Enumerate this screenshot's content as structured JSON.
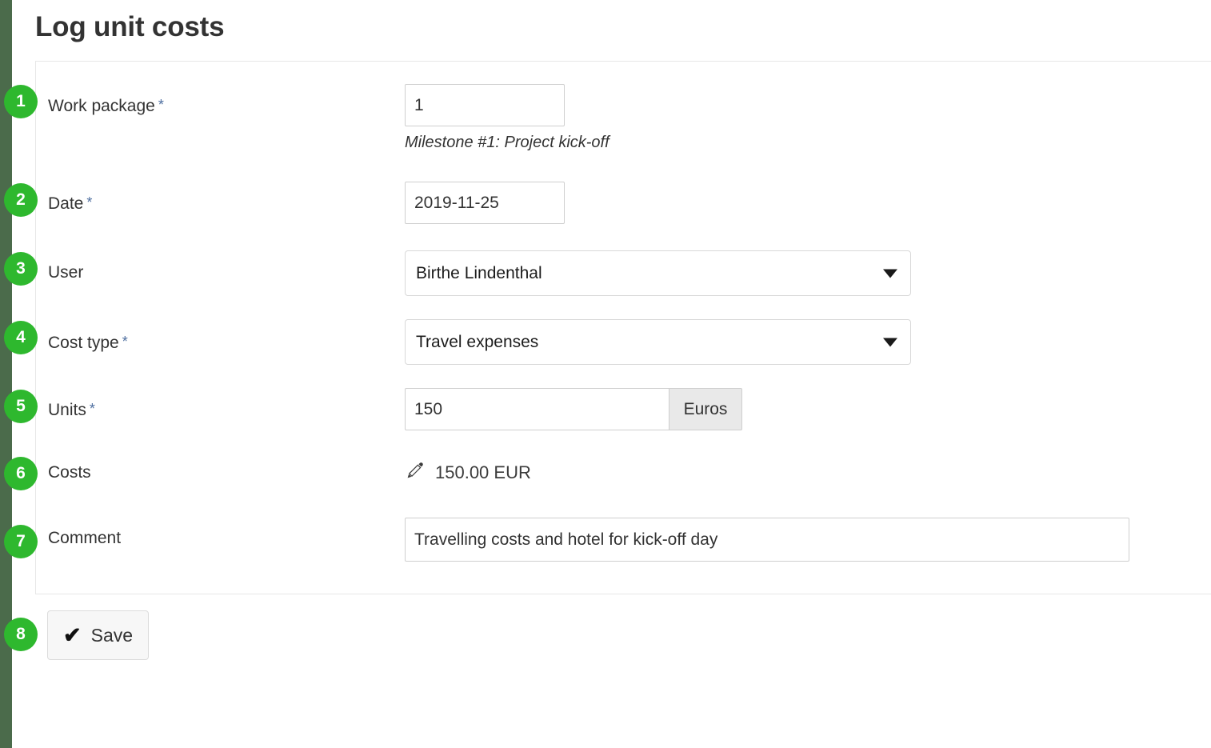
{
  "page": {
    "title": "Log unit costs"
  },
  "form": {
    "rows": [
      {
        "label": "Work package",
        "required": true,
        "required_marker": "*",
        "value": "1",
        "hint": "Milestone #1: Project kick-off"
      },
      {
        "label": "Date",
        "required": true,
        "required_marker": "*",
        "value": "2019-11-25"
      },
      {
        "label": "User",
        "required": false,
        "value": "Birthe Lindenthal"
      },
      {
        "label": "Cost type",
        "required": true,
        "required_marker": "*",
        "value": "Travel expenses"
      },
      {
        "label": "Units",
        "required": true,
        "required_marker": "*",
        "value": "150",
        "addon": "Euros"
      },
      {
        "label": "Costs",
        "required": false,
        "value": "150.00 EUR",
        "icon": "pencil-icon"
      },
      {
        "label": "Comment",
        "required": false,
        "value": "Travelling costs and hotel for kick-off day"
      }
    ]
  },
  "actions": {
    "save_label": "Save",
    "save_icon": "check-icon",
    "check_glyph": "✔"
  },
  "annotations": {
    "badges": [
      "1",
      "2",
      "3",
      "4",
      "5",
      "6",
      "7",
      "8"
    ]
  },
  "colors": {
    "badge_green": "#2eb82e",
    "edge_strip": "#4b6b4b",
    "required_star": "#4f6fa0",
    "label_text": "#333333"
  }
}
